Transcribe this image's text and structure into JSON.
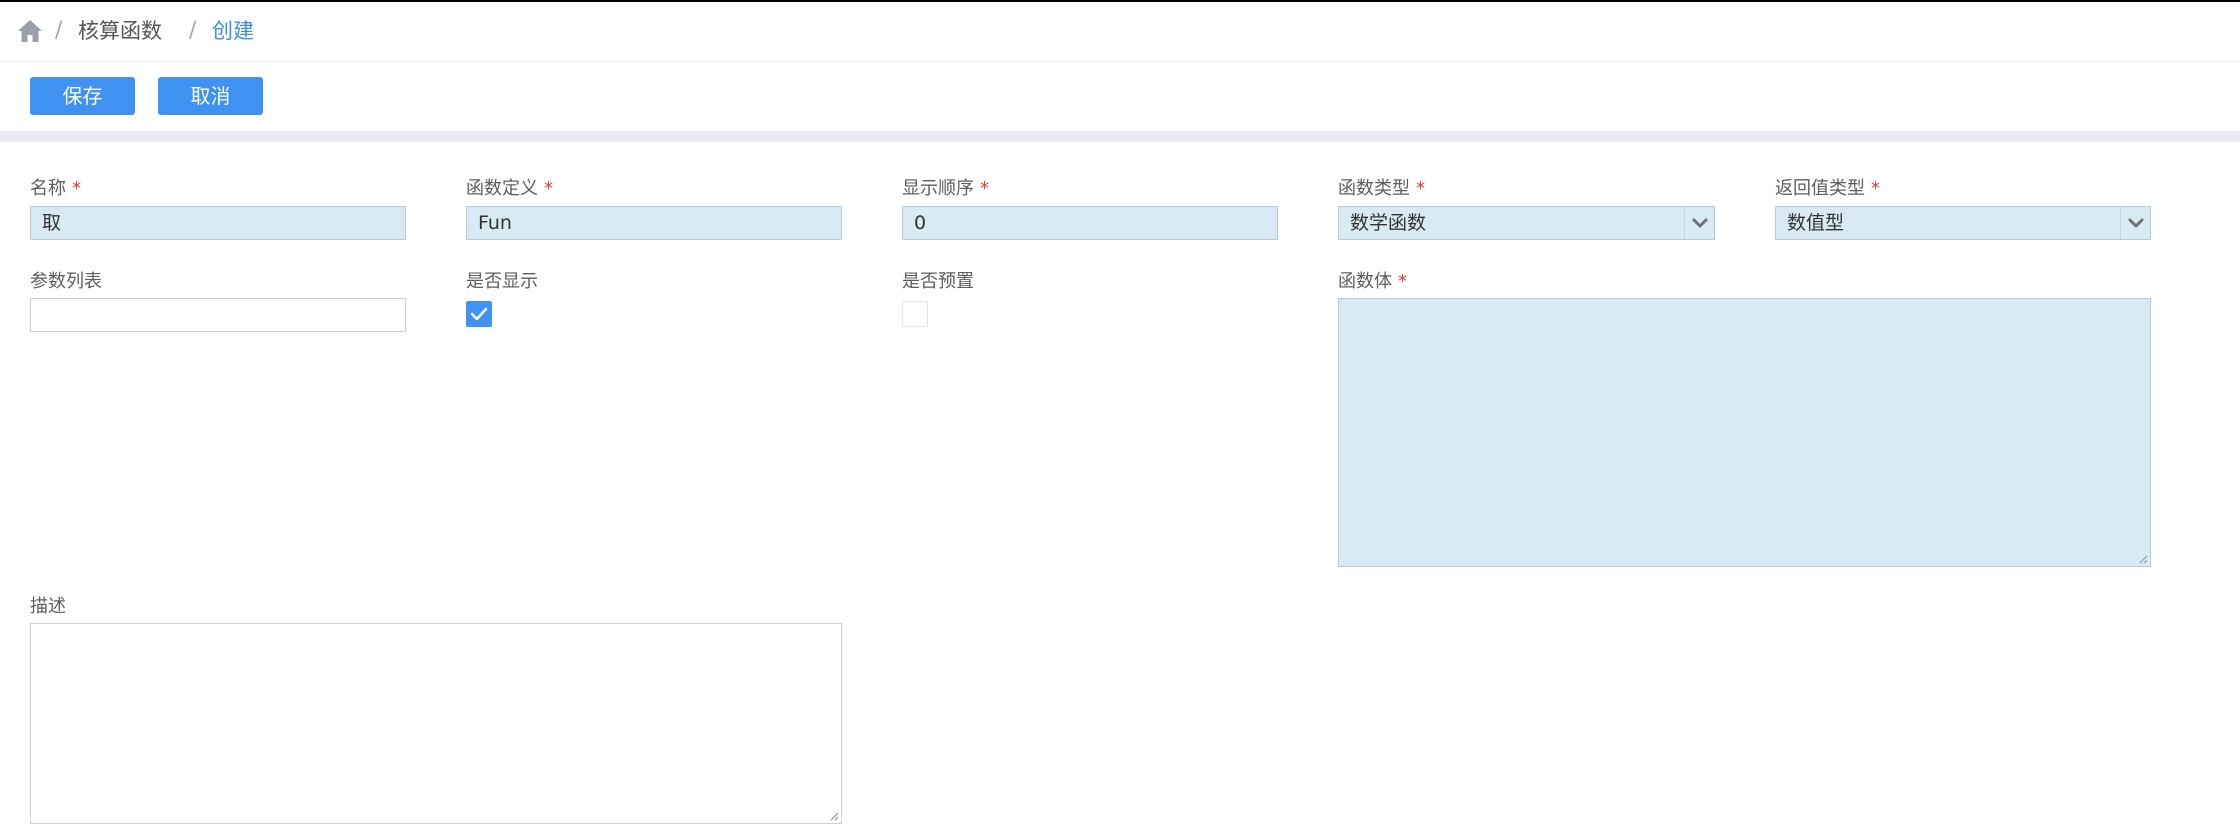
{
  "breadcrumb": {
    "home_icon": "home-icon",
    "separator": "/",
    "items": [
      "核算函数",
      "创建"
    ]
  },
  "toolbar": {
    "save_label": "保存",
    "cancel_label": "取消"
  },
  "form": {
    "required_mark": "*",
    "name": {
      "label": "名称",
      "value": "取"
    },
    "func_def": {
      "label": "函数定义",
      "value": "Fun"
    },
    "display_order": {
      "label": "显示顺序",
      "value": "0"
    },
    "func_type": {
      "label": "函数类型",
      "value": "数学函数"
    },
    "return_type": {
      "label": "返回值类型",
      "value": "数值型"
    },
    "param_list": {
      "label": "参数列表",
      "value": ""
    },
    "is_display": {
      "label": "是否显示",
      "checked": true
    },
    "is_preset": {
      "label": "是否预置",
      "checked": false
    },
    "func_body": {
      "label": "函数体",
      "value": ""
    },
    "description": {
      "label": "描述",
      "value": ""
    }
  },
  "colors": {
    "accent": "#3f91f2",
    "link": "#3c8ee6",
    "required": "#e53935",
    "input_fill": "#d8ebf5",
    "band": "#e9ebf1"
  }
}
